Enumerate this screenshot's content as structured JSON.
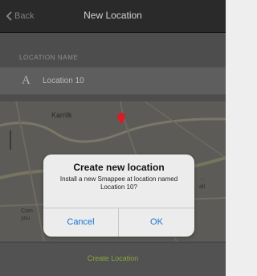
{
  "navbar": {
    "back_label": "Back",
    "title": "New Location"
  },
  "form": {
    "section_label": "LOCATION NAME",
    "name_icon": "A",
    "name_value": "Location 10"
  },
  "map": {
    "label_place": "Karrilk",
    "label_partial": "Com\nyou",
    "label_right": "…\nall"
  },
  "action": {
    "create_label": "Create Location"
  },
  "alert": {
    "title": "Create new location",
    "message": "Install a new Smappee at location named Location 10?",
    "cancel_label": "Cancel",
    "ok_label": "OK"
  },
  "colors": {
    "accent": "#1a73d8",
    "create_green": "#8aa63a",
    "pin": "#d0202a"
  }
}
